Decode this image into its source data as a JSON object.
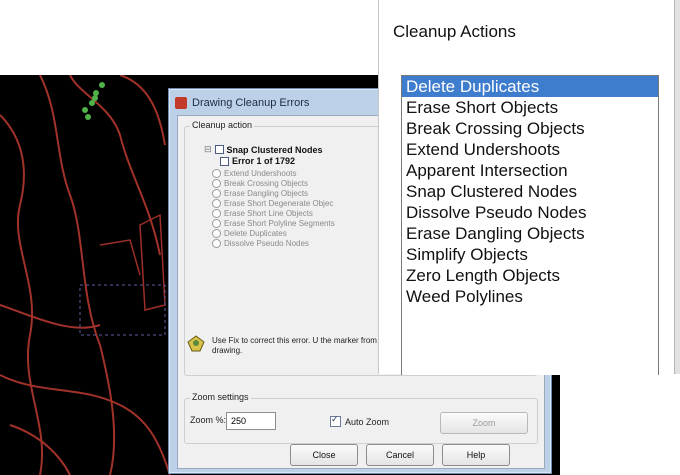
{
  "dialog": {
    "title": "Drawing Cleanup Errors",
    "cleanup_action_label": "Cleanup action",
    "tree": {
      "root": "Snap Clustered Nodes",
      "current_error": "Error 1 of 1792",
      "items": [
        "Extend Undershoots",
        "Break Crossing Objects",
        "Erase Dangling Objects",
        "Erase Short Degenerate Objec",
        "Erase Short Line Objects",
        "Erase Short Polyline Segments",
        "Delete Duplicates",
        "Dissolve Pseudo Nodes"
      ]
    },
    "hint_text": "Use Fix to correct this error. U the marker from the drawing.",
    "zoom_settings_label": "Zoom settings",
    "zoom_label": "Zoom %:",
    "zoom_value": "250",
    "auto_zoom_label": "Auto Zoom",
    "zoom_button": "Zoom",
    "close_button": "Close",
    "cancel_button": "Cancel",
    "help_button": "Help"
  },
  "panel": {
    "title": "Cleanup Actions",
    "items": [
      "Delete Duplicates",
      "Erase Short Objects",
      "Break Crossing Objects",
      "Extend Undershoots",
      "Apparent Intersection",
      "Snap Clustered Nodes",
      "Dissolve Pseudo Nodes",
      "Erase Dangling Objects",
      "Simplify Objects",
      "Zero Length Objects",
      "Weed Polylines"
    ],
    "selected_index": 0
  },
  "colors": {
    "selection": "#3e7ccd",
    "cad_lines": "#a0322a",
    "cad_background": "#000000"
  }
}
